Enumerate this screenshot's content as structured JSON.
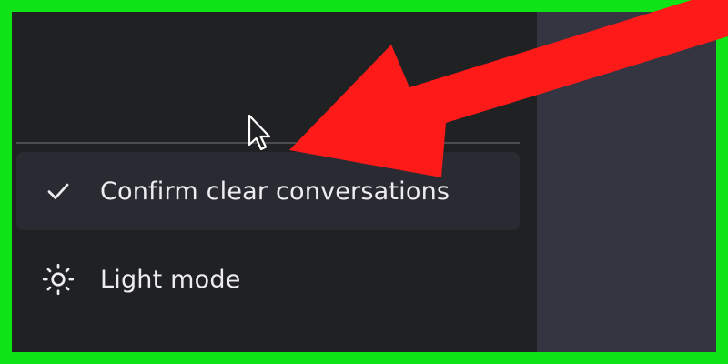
{
  "menu": {
    "items": [
      {
        "label": "Confirm clear conversations",
        "icon": "checkmark-icon",
        "checked": true
      },
      {
        "label": "Light mode",
        "icon": "sun-icon"
      }
    ]
  },
  "colors": {
    "border": "#0ee418",
    "sidebar_bg": "#202123",
    "main_bg": "#343541",
    "highlight_bg": "#2a2b32",
    "text": "#ececf1",
    "arrow": "#ff1a1a"
  }
}
